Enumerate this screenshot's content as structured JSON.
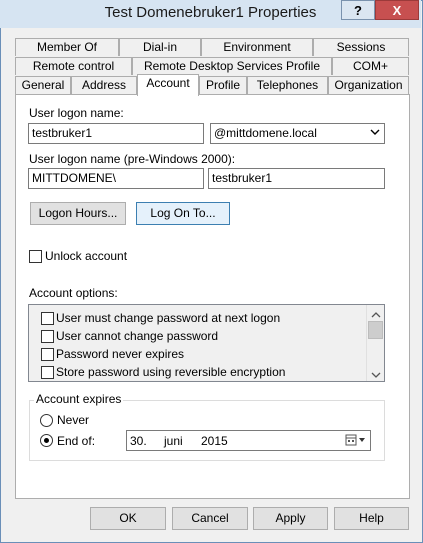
{
  "window": {
    "title": "Test Domenebruker1 Properties",
    "help_label": "?",
    "close_label": "X"
  },
  "tabs_row1": [
    "Member Of",
    "Dial-in",
    "Environment",
    "Sessions"
  ],
  "tabs_row2": [
    "Remote control",
    "Remote Desktop Services Profile",
    "COM+"
  ],
  "tabs_row3": [
    "General",
    "Address",
    "Account",
    "Profile",
    "Telephones",
    "Organization"
  ],
  "account": {
    "logon_name_label": "User logon name:",
    "logon_name_value": "testbruker1",
    "domain_value": "@mittdomene.local",
    "pre2000_label": "User logon name (pre-Windows 2000):",
    "pre2000_domain": "MITTDOMENE\\",
    "pre2000_user": "testbruker1",
    "logon_hours_button": "Logon Hours...",
    "logon_to_button": "Log On To...",
    "unlock_label": "Unlock account",
    "options_label": "Account options:",
    "options": [
      "User must change password at next logon",
      "User cannot change password",
      "Password never expires",
      "Store password using reversible encryption"
    ],
    "expires_label": "Account expires",
    "never_label": "Never",
    "end_of_label": "End of:",
    "end_date": {
      "day": "30.",
      "month": "juni",
      "year": "2015"
    }
  },
  "footer": {
    "ok": "OK",
    "cancel": "Cancel",
    "apply": "Apply",
    "help": "Help"
  }
}
